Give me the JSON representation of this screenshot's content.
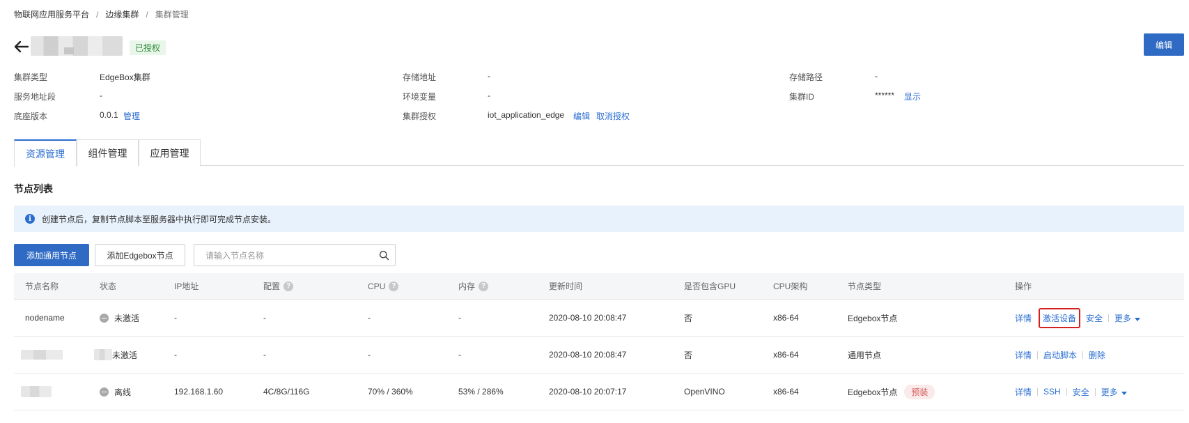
{
  "breadcrumb": [
    "物联网应用服务平台",
    "边缘集群",
    "集群管理"
  ],
  "header": {
    "status_badge": "已授权",
    "edit_label": "编辑"
  },
  "info": {
    "cluster_type_label": "集群类型",
    "cluster_type_value": "EdgeBox集群",
    "service_addr_label": "服务地址段",
    "service_addr_value": "-",
    "base_version_label": "底座版本",
    "base_version_value": "0.0.1",
    "base_version_link": "管理",
    "storage_addr_label": "存储地址",
    "storage_addr_value": "-",
    "env_label": "环境变量",
    "env_value": "-",
    "cluster_auth_label": "集群授权",
    "cluster_auth_value": "iot_application_edge",
    "cluster_auth_edit": "编辑",
    "cluster_auth_cancel": "取消授权",
    "storage_path_label": "存储路径",
    "storage_path_value": "-",
    "cluster_id_label": "集群ID",
    "cluster_id_value": "******",
    "cluster_id_show": "显示"
  },
  "tabs": [
    "资源管理",
    "组件管理",
    "应用管理"
  ],
  "section_title": "节点列表",
  "notice": "创建节点后，复制节点脚本至服务器中执行即可完成节点安装。",
  "toolbar": {
    "add_general": "添加通用节点",
    "add_edgebox": "添加Edgebox节点",
    "search_placeholder": "请输入节点名称"
  },
  "table": {
    "headers": [
      "节点名称",
      "状态",
      "IP地址",
      "配置",
      "CPU",
      "内存",
      "更新时间",
      "是否包含GPU",
      "CPU架构",
      "节点类型",
      "操作"
    ],
    "rows": [
      {
        "name": "nodename",
        "status": "未激活",
        "ip": "-",
        "config": "-",
        "cpu": "-",
        "mem": "-",
        "updated": "2020-08-10 20:08:47",
        "gpu": "否",
        "arch": "x86-64",
        "type": "Edgebox节点",
        "ops": [
          "详情",
          "激活设备",
          "安全",
          "更多"
        ]
      },
      {
        "name": "",
        "status": "未激活",
        "ip": "-",
        "config": "-",
        "cpu": "-",
        "mem": "-",
        "updated": "2020-08-10 20:08:47",
        "gpu": "否",
        "arch": "x86-64",
        "type": "通用节点",
        "ops": [
          "详情",
          "启动脚本",
          "删除"
        ]
      },
      {
        "name": "",
        "status": "离线",
        "ip": "192.168.1.60",
        "config": "4C/8G/116G",
        "cpu": "70% / 360%",
        "mem": "53% / 286%",
        "updated": "2020-08-10 20:07:17",
        "gpu": "OpenVINO",
        "arch": "x86-64",
        "type": "Edgebox节点",
        "type_tag": "预装",
        "ops": [
          "详情",
          "SSH",
          "安全",
          "更多"
        ]
      }
    ]
  },
  "colors": {
    "primary": "#2f6bc4",
    "link": "#2b6ed1",
    "highlight_border": "#d61f1f",
    "success": "#2e8b3a"
  }
}
